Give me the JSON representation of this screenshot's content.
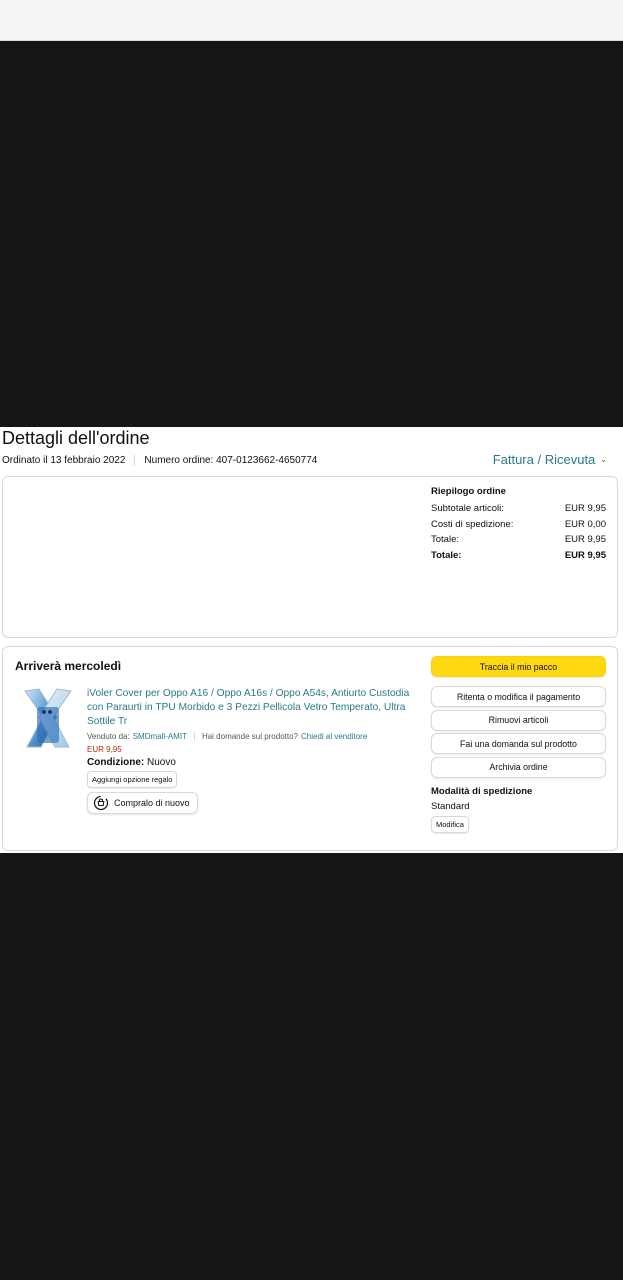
{
  "page": {
    "title": "Dettagli dell'ordine",
    "order_date": "Ordinato il 13 febbraio 2022",
    "order_number": "Numero ordine: 407-0123662-4650774",
    "invoice_link": "Fattura / Ricevuta"
  },
  "summary": {
    "heading": "Riepilogo ordine",
    "rows": [
      {
        "label": "Subtotale articoli:",
        "value": "EUR 9,95"
      },
      {
        "label": "Costi di spedizione:",
        "value": "EUR 0,00"
      },
      {
        "label": "Totale:",
        "value": "EUR 9,95"
      },
      {
        "label": "Totale:",
        "value": "EUR 9,95"
      }
    ]
  },
  "shipment": {
    "delivery_title": "Arriverà mercoledì",
    "product": {
      "title": "iVoler Cover per Oppo A16 / Oppo A16s / Oppo A54s, Antiurto Custodia con Paraurti in TPU Morbido e 3 Pezzi Pellicola Vetro Temperato, Ultra Sottile Tr",
      "sold_by_label": "Venduto da:",
      "sold_by": "SMDmall-AMIT",
      "question_label": "Hai domande sul prodotto?",
      "question_link": "Chiedi al venditore",
      "price": "EUR 9,95",
      "condition_label": "Condizione:",
      "condition_value": "Nuovo",
      "gift_button": "Aggiungi opzione regalo",
      "rebuy_button": "Compralo di nuovo"
    },
    "actions": {
      "track": "Traccia il mio pacco",
      "retry_payment": "Ritenta o modifica il pagamento",
      "remove_items": "Rimuovi articoli",
      "ask_question": "Fai una domanda sul prodotto",
      "archive": "Archivia ordine"
    },
    "shipping_method": {
      "heading": "Modalità di spedizione",
      "value": "Standard",
      "edit": "Modifica"
    }
  },
  "colors": {
    "link": "#2a7a8c",
    "primary_button": "#ffd814",
    "price": "#b12704",
    "backdrop": "#161514"
  }
}
